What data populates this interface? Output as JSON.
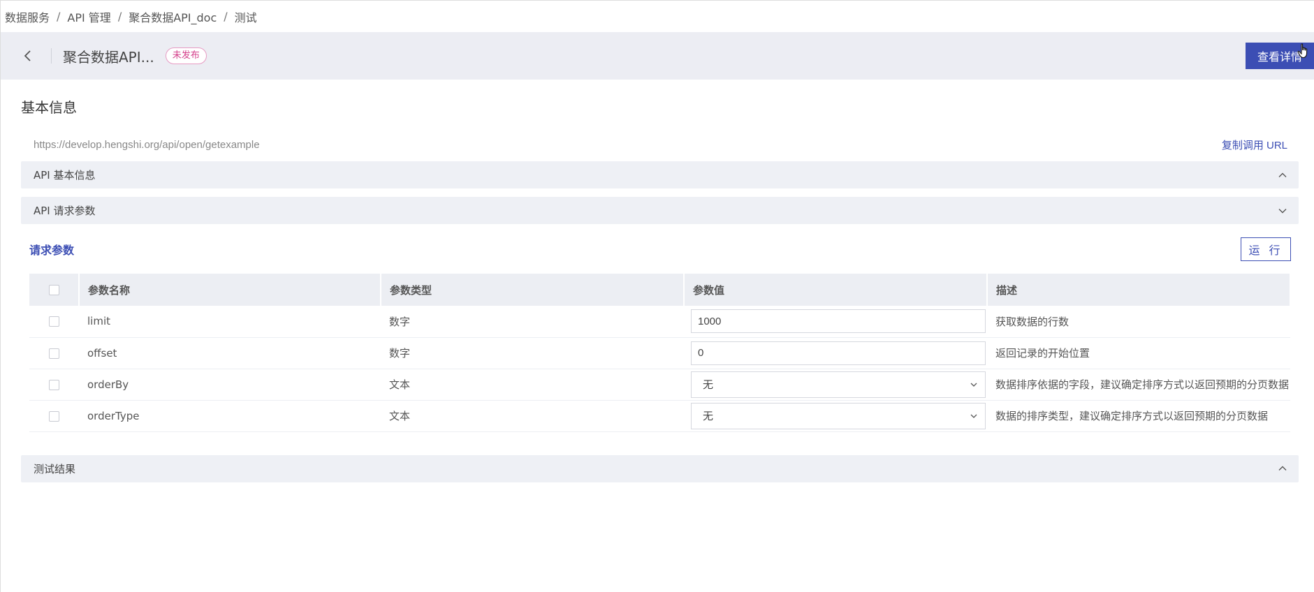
{
  "breadcrumb": [
    "数据服务",
    "API 管理",
    "聚合数据API_doc",
    "测试"
  ],
  "breadcrumb_sep": "/",
  "header": {
    "title": "聚合数据API...",
    "status": "未发布",
    "detail_button": "查看详情"
  },
  "basic_info": {
    "title": "基本信息",
    "url": "https://develop.hengshi.org/api/open/getexample",
    "copy_url": "复制调用 URL"
  },
  "panels": {
    "basic": "API 基本信息",
    "params": "API 请求参数",
    "result": "测试结果"
  },
  "request": {
    "title": "请求参数",
    "run_button": "运 行",
    "columns": [
      "参数名称",
      "参数类型",
      "参数值",
      "描述"
    ],
    "rows": [
      {
        "name": "limit",
        "type": "数字",
        "value": "1000",
        "kind": "input",
        "desc": "获取数据的行数"
      },
      {
        "name": "offset",
        "type": "数字",
        "value": "0",
        "kind": "input",
        "desc": "返回记录的开始位置"
      },
      {
        "name": "orderBy",
        "type": "文本",
        "value": "无",
        "kind": "select",
        "desc": "数据排序依据的字段，建议确定排序方式以返回预期的分页数据"
      },
      {
        "name": "orderType",
        "type": "文本",
        "value": "无",
        "kind": "select",
        "desc": "数据的排序类型，建议确定排序方式以返回预期的分页数据"
      }
    ]
  },
  "colors": {
    "primary": "#3c4eb4",
    "badge": "#d4408b",
    "panel_bg": "#eef0f5"
  }
}
